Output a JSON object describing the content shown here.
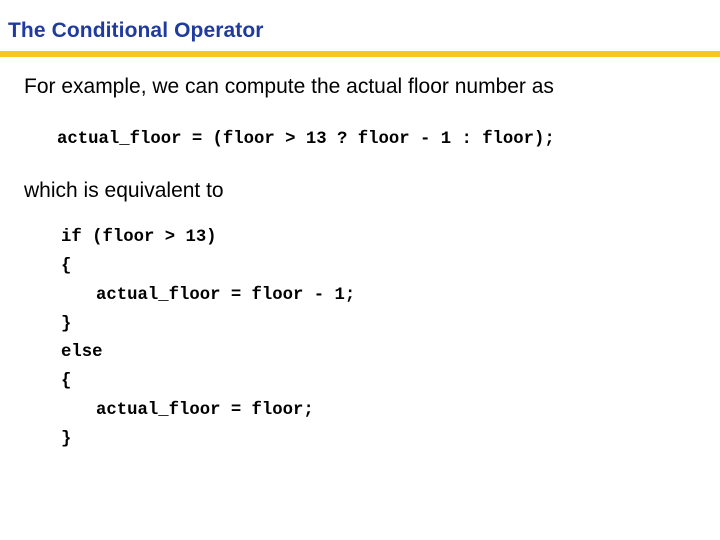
{
  "slide": {
    "title": "The Conditional Operator",
    "accent_colors": {
      "title": "#1f3b9f",
      "rule": "#f6c81c"
    },
    "intro_text": "For example, we can compute the actual floor number as",
    "ternary_code": "actual_floor = (floor > 13 ? floor - 1 : floor);",
    "equivalence_text": "which is equivalent to",
    "if_else_code": [
      {
        "text": "if (floor > 13)",
        "indent": 0
      },
      {
        "text": "{",
        "indent": 0
      },
      {
        "text": "actual_floor = floor - 1;",
        "indent": 1
      },
      {
        "text": "}",
        "indent": 0
      },
      {
        "text": "else",
        "indent": 0
      },
      {
        "text": "{",
        "indent": 0
      },
      {
        "text": "actual_floor = floor;",
        "indent": 1
      },
      {
        "text": "}",
        "indent": 0
      }
    ]
  }
}
